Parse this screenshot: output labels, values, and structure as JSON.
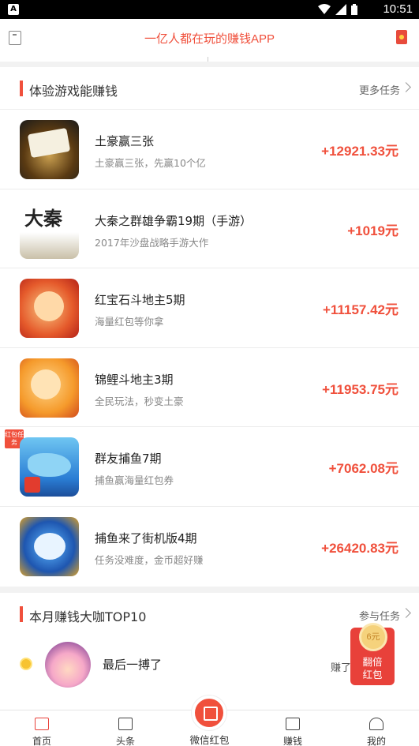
{
  "status_bar": {
    "app_badge": "A",
    "time": "10:51"
  },
  "header": {
    "title": "一亿人都在玩的赚钱APP"
  },
  "games_section": {
    "title": "体验游戏能赚钱",
    "more": "更多任务",
    "items": [
      {
        "name": "土豪赢三张",
        "desc": "土豪赢三张，先赢10个亿",
        "reward": "+12921.33元"
      },
      {
        "name": "大秦之群雄争霸19期（手游）",
        "desc": "2017年沙盘战略手游大作",
        "reward": "+1019元",
        "thumb_text": "大秦"
      },
      {
        "name": "红宝石斗地主5期",
        "desc": "海量红包等你拿",
        "reward": "+11157.42元"
      },
      {
        "name": "锦鲤斗地主3期",
        "desc": "全民玩法，秒变土豪",
        "reward": "+11953.75元"
      },
      {
        "name": "群友捕鱼7期",
        "desc": "捕鱼赢海量红包券",
        "reward": "+7062.08元",
        "tag": "红包任务"
      },
      {
        "name": "捕鱼来了街机版4期",
        "desc": "任务没难度，金币超好赚",
        "reward": "+26420.83元"
      }
    ]
  },
  "ranking_section": {
    "title": "本月赚钱大咖TOP10",
    "more": "参与任务",
    "first": {
      "name": "最后一搏了",
      "earned": "赚了"
    }
  },
  "floating_packet": {
    "coin": "6元",
    "label_line1": "翻倍",
    "label_line2": "红包"
  },
  "tabbar": {
    "tabs": [
      "首页",
      "头条",
      "微信红包",
      "赚钱",
      "我的"
    ]
  }
}
